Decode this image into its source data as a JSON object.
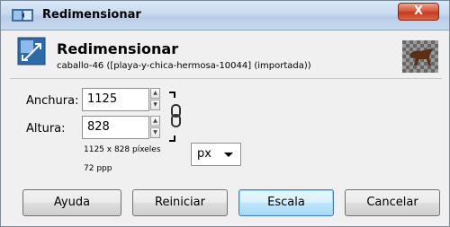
{
  "window": {
    "title": "Redimensionar",
    "close_label": "X"
  },
  "header": {
    "title": "Redimensionar",
    "subtitle": "caballo-46 ([playa-y-chica-hermosa-10044] (importada))"
  },
  "form": {
    "width_label": "Anchura:",
    "width_value": "1125",
    "height_label": "Altura:",
    "height_value": "828",
    "unit": "px",
    "size_info": "1125 x 828 píxeles",
    "resolution_info": "72 ppp"
  },
  "buttons": {
    "help": "Ayuda",
    "reset": "Reiniciar",
    "scale": "Escala",
    "cancel": "Cancelar"
  },
  "colors": {
    "titlebar": "#c9dbf0",
    "close": "#c43b1e",
    "default_button": "#bee6fd"
  },
  "icons": {
    "title": "resize-icon",
    "header": "resize-icon",
    "thumbnail": "horse-image-thumbnail",
    "chain": "chain-link-icon",
    "spin_up": "spin-up-arrow",
    "spin_down": "spin-down-arrow"
  }
}
